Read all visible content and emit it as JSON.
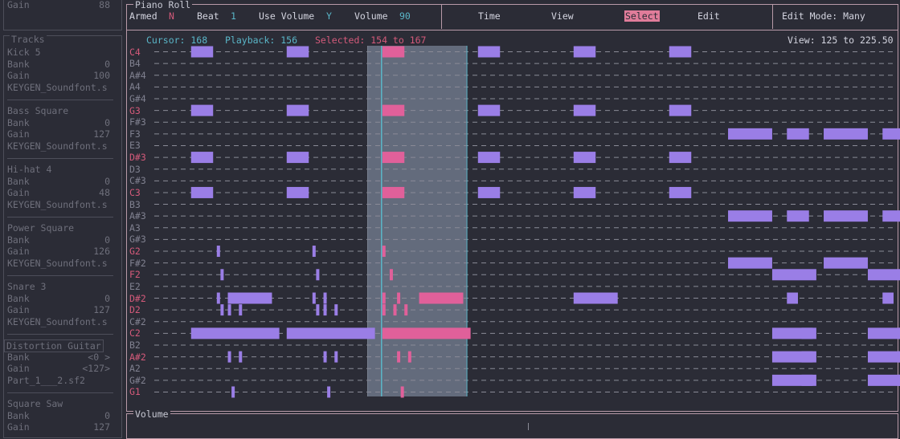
{
  "sidebar": {
    "top": {
      "label": "Gain",
      "value": "88"
    },
    "tracks_title": "Tracks",
    "tracks": [
      {
        "name": "Kick 5",
        "bank": "0",
        "gain": "100",
        "file": "KEYGEN_Soundfont.s"
      },
      {
        "name": "Bass Square",
        "bank": "0",
        "gain": "127",
        "file": "KEYGEN_Soundfont.s"
      },
      {
        "name": "Hi-hat 4",
        "bank": "0",
        "gain": "48",
        "file": "KEYGEN_Soundfont.s"
      },
      {
        "name": "Power Square",
        "bank": "0",
        "gain": "126",
        "file": "KEYGEN_Soundfont.s"
      },
      {
        "name": "Snare 3",
        "bank": "0",
        "gain": "127",
        "file": "KEYGEN_Soundfont.s"
      },
      {
        "name": "Distortion Guitar",
        "bank": "<0 >",
        "gain": "<127>",
        "file": "Part_1___2.sf2"
      },
      {
        "name": "Square Saw",
        "bank": "0",
        "gain": "127",
        "file": ""
      }
    ],
    "labels": {
      "bank": "Bank",
      "gain": "Gain"
    }
  },
  "piano_roll": {
    "title": "Piano Roll",
    "armed_label": "Armed",
    "armed_value": "N",
    "beat_label": "Beat",
    "beat_value": "1",
    "use_volume_label": "Use Volume",
    "use_volume_value": "Y",
    "volume_label": "Volume",
    "volume_value": "90",
    "menu": [
      "Time",
      "View",
      "Select",
      "Edit"
    ],
    "active_menu": "Select",
    "edit_mode": "Edit Mode: Many",
    "cursor_label": "Cursor: 168",
    "playback_label": "Playback: 156",
    "selected_label": "Selected: 154 to 167",
    "view_label": "View: 125 to 225.50",
    "view_range": [
      125,
      225.5
    ],
    "cursor": 168,
    "playback": 156,
    "selection": [
      154,
      167
    ],
    "notes": [
      "C4",
      "B4",
      "A#4",
      "A4",
      "G#4",
      "G3",
      "F#3",
      "F3",
      "E3",
      "D#3",
      "D3",
      "C#3",
      "C3",
      "B3",
      "A#3",
      "A3",
      "G#3",
      "G2",
      "F#2",
      "F2",
      "E2",
      "D#2",
      "D2",
      "C#2",
      "C2",
      "B2",
      "A#2",
      "A2",
      "G#2",
      "G1"
    ],
    "highlight_notes": [
      "C4",
      "G3",
      "D#3",
      "C3",
      "G2",
      "F2",
      "D#2",
      "D2",
      "C2",
      "A#2",
      "G1"
    ],
    "events": [
      {
        "n": "C4",
        "t": 130,
        "d": 3
      },
      {
        "n": "C4",
        "t": 143,
        "d": 3
      },
      {
        "n": "C4",
        "t": 156,
        "d": 3
      },
      {
        "n": "C4",
        "t": 169,
        "d": 3
      },
      {
        "n": "C4",
        "t": 182,
        "d": 3
      },
      {
        "n": "C4",
        "t": 195,
        "d": 3
      },
      {
        "n": "G3",
        "t": 130,
        "d": 3
      },
      {
        "n": "G3",
        "t": 143,
        "d": 3
      },
      {
        "n": "G3",
        "t": 156,
        "d": 3
      },
      {
        "n": "G3",
        "t": 169,
        "d": 3
      },
      {
        "n": "G3",
        "t": 182,
        "d": 3
      },
      {
        "n": "G3",
        "t": 195,
        "d": 3
      },
      {
        "n": "D#3",
        "t": 130,
        "d": 3
      },
      {
        "n": "D#3",
        "t": 143,
        "d": 3
      },
      {
        "n": "D#3",
        "t": 156,
        "d": 3
      },
      {
        "n": "D#3",
        "t": 169,
        "d": 3
      },
      {
        "n": "D#3",
        "t": 182,
        "d": 3
      },
      {
        "n": "D#3",
        "t": 195,
        "d": 3
      },
      {
        "n": "C3",
        "t": 130,
        "d": 3
      },
      {
        "n": "C3",
        "t": 143,
        "d": 3
      },
      {
        "n": "C3",
        "t": 156,
        "d": 3
      },
      {
        "n": "C3",
        "t": 169,
        "d": 3
      },
      {
        "n": "C3",
        "t": 182,
        "d": 3
      },
      {
        "n": "C3",
        "t": 195,
        "d": 3
      },
      {
        "n": "F3",
        "t": 203,
        "d": 6
      },
      {
        "n": "F3",
        "t": 211,
        "d": 3
      },
      {
        "n": "F3",
        "t": 216,
        "d": 6
      },
      {
        "n": "F3",
        "t": 224,
        "d": 3
      },
      {
        "n": "A#3",
        "t": 203,
        "d": 6
      },
      {
        "n": "A#3",
        "t": 211,
        "d": 3
      },
      {
        "n": "A#3",
        "t": 216,
        "d": 6
      },
      {
        "n": "A#3",
        "t": 224,
        "d": 3
      },
      {
        "n": "F#2",
        "t": 203,
        "d": 6
      },
      {
        "n": "F#2",
        "t": 216,
        "d": 6
      },
      {
        "n": "F2",
        "t": 209,
        "d": 6
      },
      {
        "n": "F2",
        "t": 222,
        "d": 6
      },
      {
        "n": "D#2",
        "t": 135,
        "d": 6
      },
      {
        "n": "D#2",
        "t": 161,
        "d": 6
      },
      {
        "n": "D#2",
        "t": 182,
        "d": 6
      },
      {
        "n": "D#2",
        "t": 211,
        "d": 1.5
      },
      {
        "n": "D#2",
        "t": 224,
        "d": 1.5
      },
      {
        "n": "C2",
        "t": 130,
        "d": 12
      },
      {
        "n": "C2",
        "t": 143,
        "d": 12
      },
      {
        "n": "C2",
        "t": 156,
        "d": 12
      },
      {
        "n": "C2",
        "t": 209,
        "d": 6
      },
      {
        "n": "C2",
        "t": 213,
        "d": 1.5
      },
      {
        "n": "C2",
        "t": 222,
        "d": 6
      },
      {
        "n": "C2",
        "t": 226,
        "d": 1.5
      },
      {
        "n": "A#2",
        "t": 209,
        "d": 6
      },
      {
        "n": "A#2",
        "t": 213,
        "d": 1.5
      },
      {
        "n": "A#2",
        "t": 222,
        "d": 6
      },
      {
        "n": "A#2",
        "t": 226,
        "d": 1.5
      },
      {
        "n": "G#2",
        "t": 209,
        "d": 6
      },
      {
        "n": "G#2",
        "t": 213,
        "d": 1.5
      },
      {
        "n": "G#2",
        "t": 222,
        "d": 6
      },
      {
        "n": "G#2",
        "t": 226,
        "d": 1.5
      }
    ],
    "ticks": [
      {
        "n": "G2",
        "t": [
          133.5,
          146.5,
          156
        ]
      },
      {
        "n": "F2",
        "t": [
          134,
          147,
          157
        ]
      },
      {
        "n": "D#2",
        "t": [
          133.5,
          135,
          146.5,
          148,
          156,
          158
        ]
      },
      {
        "n": "D2",
        "t": [
          134,
          135,
          136.5,
          147,
          148,
          149.5,
          156,
          157.5,
          159
        ]
      },
      {
        "n": "A#2",
        "t": [
          135,
          136.5,
          148,
          149.5,
          158,
          159.5
        ]
      },
      {
        "n": "G1",
        "t": [
          135.5,
          148.5,
          158.5
        ]
      }
    ]
  },
  "volume_panel": {
    "title": "Volume"
  },
  "colors": {
    "note": "#9a7ee6",
    "note_selected": "#e0609a",
    "selection_bg": "#636b7c",
    "cursor_line": "#5ab6c8",
    "frame": "#b89aa8"
  }
}
